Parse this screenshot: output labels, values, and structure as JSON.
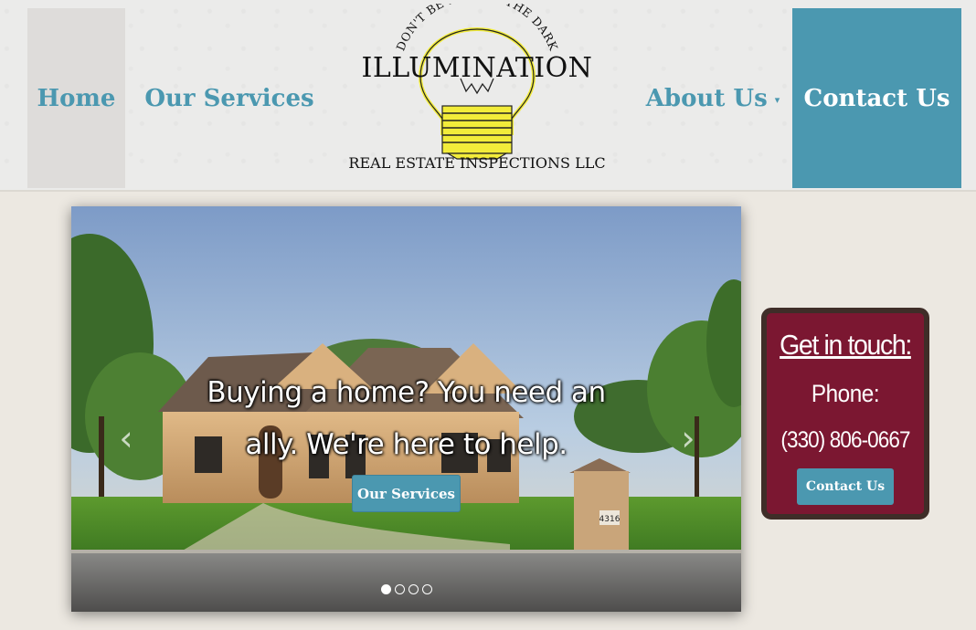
{
  "nav": {
    "home": "Home",
    "services": "Our Services",
    "about": "About Us",
    "about_caret": "▾",
    "contact": "Contact Us"
  },
  "logo": {
    "arc_text": "DON'T BE LEFT IN THE DARK",
    "name": "ILLUMINATION",
    "tagline": "REAL ESTATE INSPECTIONS LLC"
  },
  "hero": {
    "caption_line1": "Buying a home? You need an",
    "caption_line2": "ally. We're here to help.",
    "button": "Our Services",
    "prev_icon": "‹",
    "next_icon": "›",
    "house_number": "4316",
    "slides_total": 4,
    "active_slide": 1
  },
  "contact_card": {
    "title": "Get in touch:",
    "phone_label": "Phone:",
    "phone": "(330) 806-0667",
    "button": "Contact Us"
  },
  "colors": {
    "accent": "#4b98b0",
    "card_bg": "#7b1731",
    "card_border": "#3f2d28",
    "page_bg": "#ece8e1",
    "bulb": "#f2ec3a"
  },
  "icons": [
    "lightbulb-icon",
    "chevron-left-icon",
    "chevron-right-icon",
    "caret-down-icon"
  ]
}
